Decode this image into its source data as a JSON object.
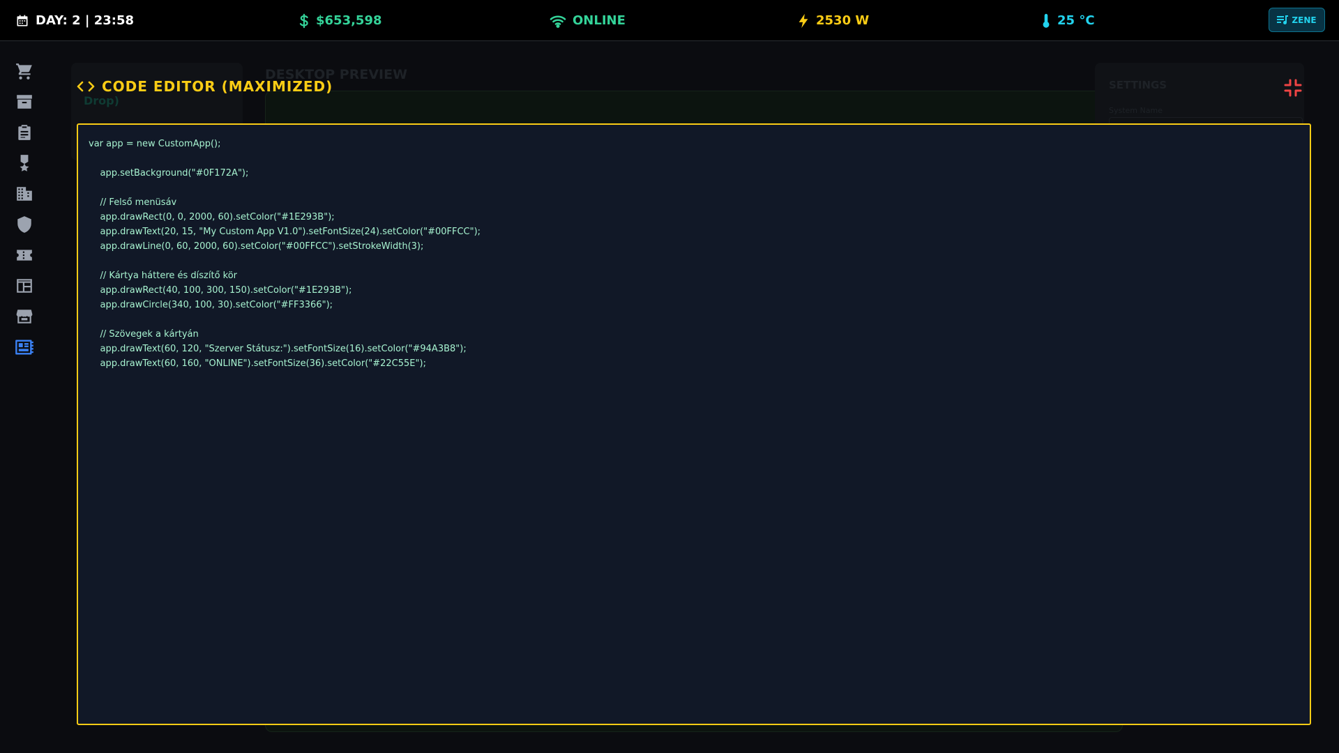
{
  "topbar": {
    "day": "DAY: 2 | 23:58",
    "money": "$653,598",
    "network": "ONLINE",
    "power": "2530 W",
    "temperature": "25 °C",
    "music_label": "ZENE"
  },
  "sidebar": {
    "items": [
      {
        "icon": "cart-icon"
      },
      {
        "icon": "archive-icon"
      },
      {
        "icon": "clipboard-icon"
      },
      {
        "icon": "medal-icon"
      },
      {
        "icon": "building-icon"
      },
      {
        "icon": "shield-icon"
      },
      {
        "icon": "ticket-icon"
      },
      {
        "icon": "layout-icon"
      },
      {
        "icon": "store-icon"
      },
      {
        "icon": "dashboard-icon",
        "active": true
      }
    ]
  },
  "background": {
    "left_panel_text": "Drop)",
    "preview_title": "DESKTOP PREVIEW",
    "settings_title": "SETTINGS",
    "settings_label": "System Name"
  },
  "editor": {
    "title": "CODE EDITOR (MAXIMIZED)",
    "lines": [
      "var app = new CustomApp();",
      "",
      "    app.setBackground(\"#0F172A\");",
      "",
      "    // Felső menüsáv",
      "    app.drawRect(0, 0, 2000, 60).setColor(\"#1E293B\");",
      "    app.drawText(20, 15, \"My Custom App V1.0\").setFontSize(24).setColor(\"#00FFCC\");",
      "    app.drawLine(0, 60, 2000, 60).setColor(\"#00FFCC\").setStrokeWidth(3);",
      "",
      "    // Kártya háttere és díszítő kör",
      "    app.drawRect(40, 100, 300, 150).setColor(\"#1E293B\");",
      "    app.drawCircle(340, 100, 30).setColor(\"#FF3366\");",
      "",
      "    // Szövegek a kártyán",
      "    app.drawText(60, 120, \"Szerver Státusz:\").setFontSize(16).setColor(\"#94A3B8\");",
      "    app.drawText(60, 160, \"ONLINE\").setFontSize(36).setColor(\"#22C55E\");"
    ]
  },
  "colors": {
    "accent_yellow": "#FACC15",
    "money_green": "#34D399",
    "temp_cyan": "#22D3EE",
    "active_blue": "#3B82F6",
    "minimize_red": "#EF4444",
    "editor_bg": "#111827",
    "code_text": "#A7F3D0"
  }
}
